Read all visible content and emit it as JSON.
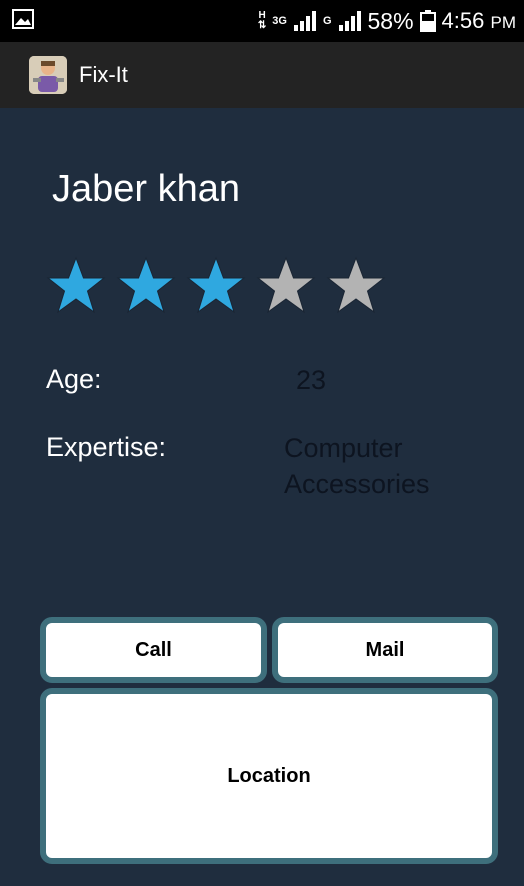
{
  "status_bar": {
    "network_label_1": "H",
    "network_label_2": "3G",
    "network_label_3": "G",
    "battery": "58%",
    "time": "4:56",
    "time_suffix": "PM"
  },
  "app_bar": {
    "title": "Fix-It"
  },
  "profile": {
    "name": "Jaber khan",
    "rating": 3,
    "rating_max": 5,
    "age_label": "Age:",
    "age_value": "23",
    "expertise_label": "Expertise:",
    "expertise_line1": "Computer",
    "expertise_line2": "Accessories"
  },
  "actions": {
    "call_label": "Call",
    "mail_label": "Mail",
    "location_label": "Location"
  },
  "colors": {
    "background": "#1f2d3e",
    "star_filled": "#2fa8e0",
    "star_empty": "#b3b3b3",
    "button_border": "#3e6f7c"
  }
}
